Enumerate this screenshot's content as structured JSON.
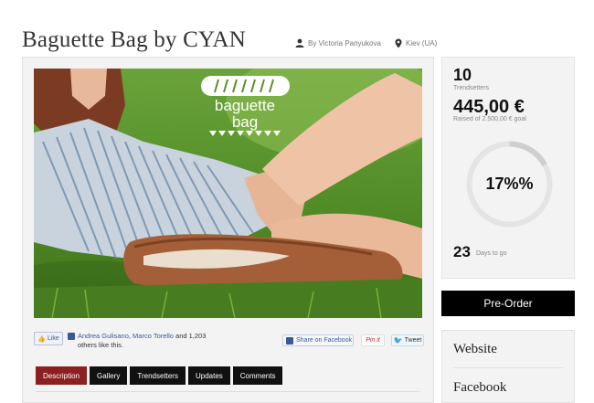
{
  "project": {
    "title": "Baguette Bag by CYAN",
    "author": "By Victoria Panyukova",
    "location": "Kiev (UA)"
  },
  "hero": {
    "logo_line1": "baguette",
    "logo_line2": "bag"
  },
  "social": {
    "like_label": "Like",
    "friend1": "Andrea Gulisano",
    "separator": ", ",
    "friend2": "Marco Torello",
    "rest": " and 1,203 others like this.",
    "share_facebook": "Share on Facebook",
    "pin_it": "Pin it",
    "tweet": "Tweet"
  },
  "tabs": [
    {
      "label": "Description",
      "active": true
    },
    {
      "label": "Gallery",
      "active": false
    },
    {
      "label": "Trendsetters",
      "active": false
    },
    {
      "label": "Updates",
      "active": false
    },
    {
      "label": "Comments",
      "active": false
    }
  ],
  "stats": {
    "trendsetters_count": "10",
    "trendsetters_label": "Trendsetters",
    "raised_amount": "445,00 €",
    "raised_goal": "Raised of 2.500,00 € goal",
    "percent_text": "17%%",
    "percent_value": 0.17,
    "days_count": "23",
    "days_label": "Days to go"
  },
  "preorder_label": "Pre-Order",
  "links": {
    "website": "Website",
    "facebook": "Facebook"
  },
  "colors": {
    "active_tab": "#8c1f1f",
    "tab": "#111111",
    "facebook_blue": "#3b5998",
    "ring_track": "#e4e4e4"
  }
}
